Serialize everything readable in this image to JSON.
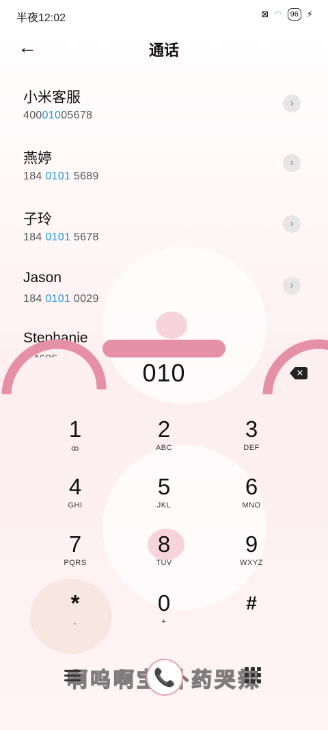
{
  "status_bar": {
    "time": "半夜12:02",
    "battery": "96"
  },
  "header": {
    "title": "通话",
    "back_icon": "arrow-left-icon"
  },
  "contacts": [
    {
      "name": "小米客服",
      "number_pre": "400",
      "number_hl": "010",
      "number_post": "05678"
    },
    {
      "name": "燕婷",
      "number_pre": "184 ",
      "number_hl": "0101",
      "number_post": " 5689"
    },
    {
      "name": "子玲",
      "number_pre": "184 ",
      "number_hl": "0101",
      "number_post": " 5678"
    },
    {
      "name": "Jason",
      "number_pre": "184 ",
      "number_hl": "0101",
      "number_post": " 0029"
    },
    {
      "name": "Stephanie",
      "number_pre": "1",
      "number_hl": "",
      "number_post": "    4685"
    }
  ],
  "dialer": {
    "input": "010",
    "backspace_icon": "backspace-icon"
  },
  "keypad": [
    {
      "digit": "1",
      "letters": "ꝏ"
    },
    {
      "digit": "2",
      "letters": "ABC"
    },
    {
      "digit": "3",
      "letters": "DEF"
    },
    {
      "digit": "4",
      "letters": "GHI"
    },
    {
      "digit": "5",
      "letters": "JKL"
    },
    {
      "digit": "6",
      "letters": "MNO"
    },
    {
      "digit": "7",
      "letters": "PQRS"
    },
    {
      "digit": "8",
      "letters": "TUV"
    },
    {
      "digit": "9",
      "letters": "WXYZ"
    },
    {
      "digit": "*",
      "letters": ","
    },
    {
      "digit": "0",
      "letters": "+"
    },
    {
      "digit": "#",
      "letters": ""
    }
  ],
  "bottom": {
    "banner": "啊呜啊宝  补药哭辣",
    "call_icon": "phone-icon",
    "menu_icon": "menu-icon",
    "keypad_icon": "keypad-icon"
  }
}
